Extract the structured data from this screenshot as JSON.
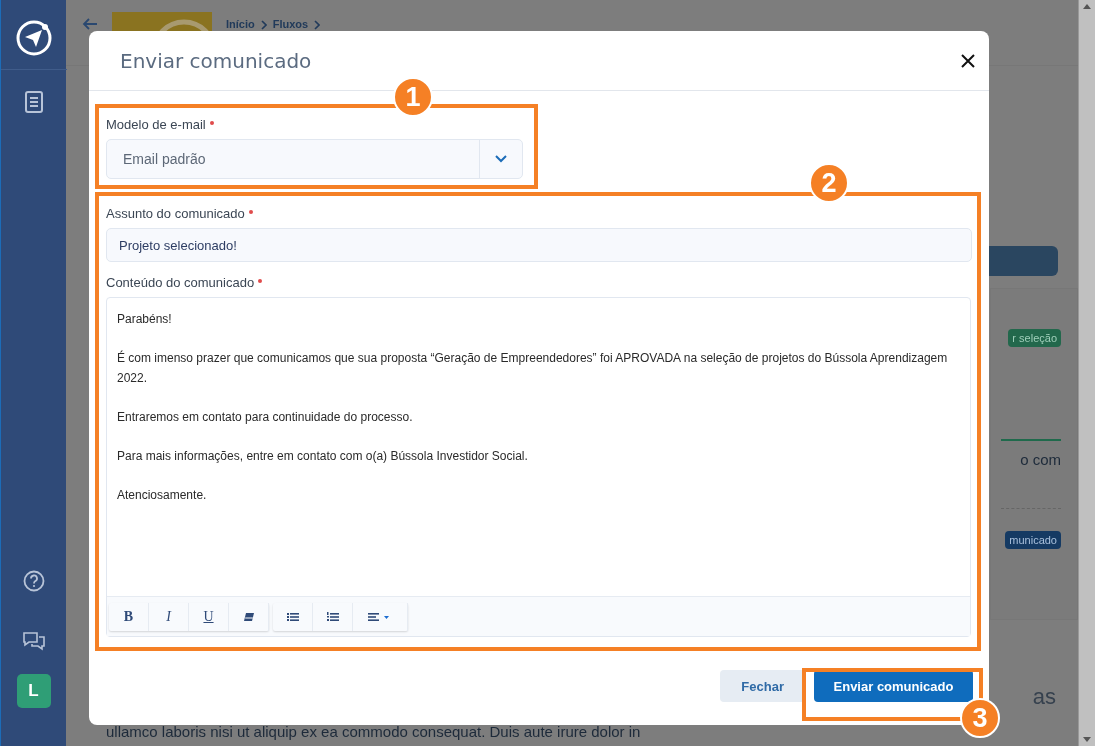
{
  "sidebar": {
    "avatar": "L"
  },
  "header": {
    "breadcrumb": [
      "Início",
      "Fluxos"
    ]
  },
  "side_panel": {
    "status_badge": "r seleção",
    "text": "o com",
    "action_badge": "municado",
    "heading": "as"
  },
  "body_text": "ullamco laboris nisi ut aliquip ex ea commodo consequat. Duis aute irure dolor in",
  "modal": {
    "title": "Enviar comunicado",
    "fields": [
      {
        "kind": "select",
        "label": "Modelo de e-mail",
        "required": true,
        "value": "Email padrão"
      },
      {
        "kind": "text",
        "label": "Assunto do comunicado",
        "required": true,
        "value": "Projeto selecionado!"
      },
      {
        "kind": "editor",
        "label": "Conteúdo do comunicado",
        "required": true,
        "paragraphs": [
          "Parabéns!",
          "É com imenso prazer que comunicamos que sua proposta “Geração de Empreendedores” foi APROVADA na seleção de projetos do Bússola Aprendizagem 2022.",
          "Entraremos em contato para continuidade do processo.",
          "Para mais informações, entre em contato com o(a) Bússola Investidor Social.",
          "Atenciosamente."
        ],
        "toolbar": [
          [
            {
              "kind": "bold",
              "label": "B"
            },
            {
              "kind": "italic",
              "label": "I"
            },
            {
              "kind": "underline",
              "label": "U"
            },
            {
              "kind": "eraser"
            }
          ],
          [
            {
              "kind": "bullets"
            },
            {
              "kind": "numbers"
            },
            {
              "kind": "align"
            }
          ]
        ]
      }
    ],
    "buttons": [
      {
        "kind": "secondary",
        "label": "Fechar"
      },
      {
        "kind": "primary",
        "label": "Enviar comunicado"
      }
    ]
  },
  "annotations": [
    "1",
    "2",
    "3"
  ]
}
